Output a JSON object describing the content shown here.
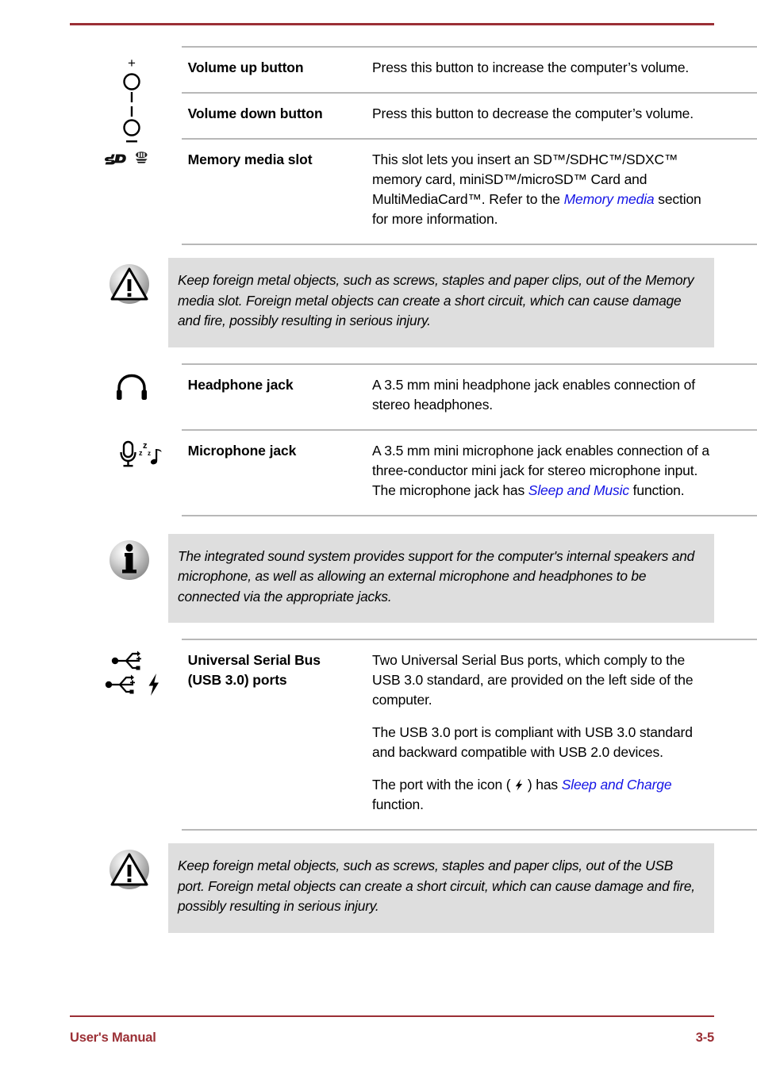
{
  "document": {
    "footer_left": "User's Manual",
    "footer_page": "3-5",
    "accent_color": "#9B2F35",
    "link_color": "#1414E6",
    "note_bg_color": "#DEDEDE"
  },
  "rows": [
    {
      "icon": "volume-up-icon",
      "term": "Volume up button",
      "desc_parts": [
        {
          "text": "Press this button to increase the computer’s volume."
        }
      ]
    },
    {
      "icon": "volume-down-icon",
      "term": "Volume down button",
      "desc_parts": [
        {
          "text": "Press this button to decrease the computer’s volume."
        }
      ]
    },
    {
      "icon": "memory-media-slot-icon",
      "term": "Memory media slot",
      "desc_parts": [
        {
          "text": "This slot lets you insert an SD™/SDHC™/SDXC™ memory card, miniSD™/microSD™ Card and MultiMediaCard™. Refer to the "
        },
        {
          "text": "Memory media",
          "link": true
        },
        {
          "text": " section for more information."
        }
      ]
    },
    {
      "icon": "headphone-jack-icon",
      "term": "Headphone jack",
      "desc_parts": [
        {
          "text": "A 3.5 mm mini headphone jack enables connection of stereo headphones."
        }
      ]
    },
    {
      "icon": "microphone-jack-icon",
      "term": "Microphone jack",
      "desc_parts": [
        {
          "text": "A 3.5 mm mini microphone jack enables connection of a three-conductor mini jack for stereo microphone input."
        },
        {
          "text": "The microphone jack has "
        },
        {
          "text": "Sleep and Music",
          "link": true
        },
        {
          "text": " function."
        }
      ]
    },
    {
      "icon": "usb-ports-icon",
      "term": "Universal Serial Bus (USB 3.0) ports",
      "desc_parts": []
    }
  ],
  "table": {
    "volume_up": {
      "term": "Volume up button",
      "desc": "Press this button to increase the computer’s volume."
    },
    "volume_down": {
      "term": "Volume down button",
      "desc": "Press this button to decrease the computer’s volume."
    },
    "memory_media": {
      "term": "Memory media slot",
      "desc_before": "This slot lets you insert an SD™/SDHC™/SDXC™ memory card, miniSD™/microSD™ Card and MultiMediaCard™. Refer to the ",
      "link": "Memory media",
      "desc_after": " section for more information."
    },
    "headphone": {
      "term": "Headphone jack",
      "desc": "A 3.5 mm mini headphone jack enables connection of stereo headphones."
    },
    "microphone": {
      "term": "Microphone jack",
      "desc_p1": "A 3.5 mm mini microphone jack enables connection of a three-conductor mini jack for stereo microphone input.",
      "desc_p2_before": "The microphone jack has ",
      "link": "Sleep and Music",
      "desc_p2_after": " function."
    },
    "usb": {
      "term_line1": "Universal Serial Bus",
      "term_line2": "(USB 3.0) ports",
      "desc_p1": "Two Universal Serial Bus ports, which comply to the USB 3.0 standard, are provided on the left side of the computer.",
      "desc_p2": "The USB 3.0 port is compliant with USB 3.0 standard and backward compatible with USB 2.0 devices.",
      "desc_p3_before": "The port with the icon ( ",
      "desc_p3_icon": "⚡",
      "desc_p3_mid": " ) has ",
      "link": "Sleep and Charge",
      "desc_p3_after": " function."
    }
  },
  "notes": [
    {
      "id": "memory-media-warning",
      "icon": "warning-triangle-icon",
      "text": "Keep foreign metal objects, such as screws, staples and paper clips, out of the Memory media slot. Foreign metal objects can create a short circuit, which can cause damage and fire, possibly resulting in serious injury."
    },
    {
      "id": "sound-system-info",
      "icon": "information-icon",
      "text": "The integrated sound system provides support for the computer's internal speakers and microphone, as well as allowing an external microphone and headphones to be connected via the appropriate jacks."
    },
    {
      "id": "usb-port-warning",
      "icon": "warning-triangle-icon",
      "text": "Keep foreign metal objects, such as screws, staples and paper clips, out of the USB port. Foreign metal objects can create a short circuit, which can cause damage and fire, possibly resulting in serious injury."
    }
  ]
}
